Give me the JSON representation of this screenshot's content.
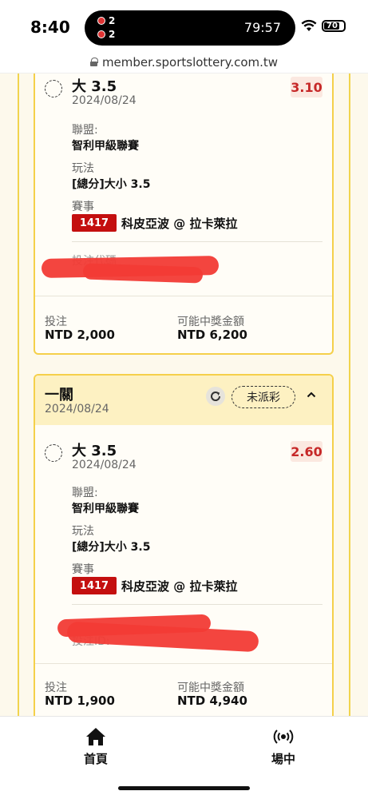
{
  "status_bar": {
    "time": "8:40",
    "live_scores": [
      "2",
      "2"
    ],
    "island_clock": "79:57",
    "battery": "70"
  },
  "browser": {
    "url": "member.sportslottery.com.tw"
  },
  "ticket1": {
    "selection": {
      "pick": "大 3.5",
      "date": "2024/08/24",
      "odds": "3.10",
      "league_label": "聯盟:",
      "league": "智利甲級聯賽",
      "market_label": "玩法",
      "market": "[總分]大小 3.5",
      "event_label": "賽事",
      "event_code": "1417",
      "event_name": "科皮亞波 @ 拉卡萊拉",
      "bet_id_label": "投注代碼"
    },
    "stake_label": "投注",
    "stake": "NTD 2,000",
    "payout_label": "可能中獎金額",
    "payout": "NTD 6,200"
  },
  "ticket2": {
    "type": "一關",
    "date": "2024/08/24",
    "status": "未派彩",
    "selection": {
      "pick": "大 3.5",
      "date": "2024/08/24",
      "odds": "2.60",
      "league_label": "聯盟:",
      "league": "智利甲級聯賽",
      "market_label": "玩法",
      "market": "[總分]大小 3.5",
      "event_label": "賽事",
      "event_code": "1417",
      "event_name": "科皮亞波 @ 拉卡萊拉",
      "bet_id_label": "投注ID:"
    },
    "stake_label": "投注",
    "stake": "NTD 1,900",
    "payout_label": "可能中獎金額",
    "payout": "NTD 4,940"
  },
  "nav": {
    "home_label": "首頁",
    "live_label": "場中"
  }
}
